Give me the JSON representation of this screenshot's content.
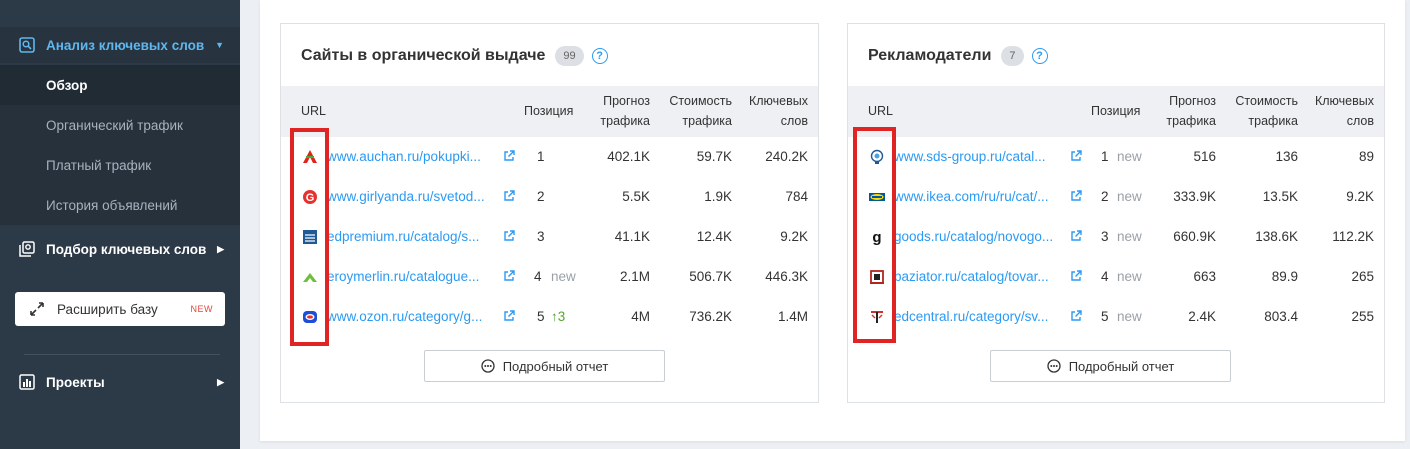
{
  "sidebar": {
    "keyword_analysis": "Анализ ключевых слов",
    "overview": "Обзор",
    "organic_traffic": "Органический трафик",
    "paid_traffic": "Платный трафик",
    "ads_history": "История объявлений",
    "keyword_selection": "Подбор ключевых слов",
    "expand_base": "Расширить базу",
    "new_tag": "NEW",
    "projects": "Проекты"
  },
  "organic": {
    "title": "Сайты в органической выдаче",
    "count": "99",
    "help": "?",
    "headers": {
      "url": "URL",
      "position": "Позиция",
      "traffic_forecast": [
        "Прогноз",
        "трафика"
      ],
      "traffic_cost": [
        "Стоимость",
        "трафика"
      ],
      "keywords": [
        "Ключевых",
        "слов"
      ]
    },
    "rows": [
      {
        "favicon": "auchan-logo-icon",
        "url": "www.auchan.ru/pokupki...",
        "position": "1",
        "pos_note": "",
        "trend": "",
        "forecast": "402.1K",
        "cost": "59.7K",
        "keywords": "240.2K"
      },
      {
        "favicon": "girlyanda-logo-icon",
        "url": "www.girlyanda.ru/svetod...",
        "position": "2",
        "pos_note": "",
        "trend": "",
        "forecast": "5.5K",
        "cost": "1.9K",
        "keywords": "784"
      },
      {
        "favicon": "ledpremium-logo-icon",
        "url": "edpremium.ru/catalog/s...",
        "position": "3",
        "pos_note": "",
        "trend": "",
        "forecast": "41.1K",
        "cost": "12.4K",
        "keywords": "9.2K"
      },
      {
        "favicon": "leroymerlin-logo-icon",
        "url": "eroymerlin.ru/catalogue...",
        "position": "4",
        "pos_note": "new",
        "trend": "",
        "forecast": "2.1M",
        "cost": "506.7K",
        "keywords": "446.3K"
      },
      {
        "favicon": "ozon-logo-icon",
        "url": "www.ozon.ru/category/g...",
        "position": "5",
        "pos_note": "",
        "trend": "↑3",
        "forecast": "4M",
        "cost": "736.2K",
        "keywords": "1.4M"
      }
    ],
    "report_button": "Подробный отчет"
  },
  "advertisers": {
    "title": "Рекламодатели",
    "count": "7",
    "help": "?",
    "headers": {
      "url": "URL",
      "position": "Позиция",
      "traffic_forecast": [
        "Прогноз",
        "трафика"
      ],
      "traffic_cost": [
        "Стоимость",
        "трафика"
      ],
      "keywords": [
        "Ключевых",
        "слов"
      ]
    },
    "rows": [
      {
        "favicon": "sds-group-logo-icon",
        "url": "www.sds-group.ru/catal...",
        "position": "1",
        "pos_note": "new",
        "forecast": "516",
        "cost": "136",
        "keywords": "89"
      },
      {
        "favicon": "ikea-logo-icon",
        "url": "www.ikea.com/ru/ru/cat/...",
        "position": "2",
        "pos_note": "new",
        "forecast": "333.9K",
        "cost": "13.5K",
        "keywords": "9.2K"
      },
      {
        "favicon": "goods-logo-icon",
        "url": "goods.ru/catalog/novogo...",
        "position": "3",
        "pos_note": "new",
        "forecast": "660.9K",
        "cost": "138.6K",
        "keywords": "112.2K"
      },
      {
        "favicon": "baziator-logo-icon",
        "url": "baziator.ru/catalog/tovar...",
        "position": "4",
        "pos_note": "new",
        "forecast": "663",
        "cost": "89.9",
        "keywords": "265"
      },
      {
        "favicon": "ledcentral-logo-icon",
        "url": "edcentral.ru/category/sv...",
        "position": "5",
        "pos_note": "new",
        "forecast": "2.4K",
        "cost": "803.4",
        "keywords": "255"
      }
    ],
    "report_button": "Подробный отчет"
  },
  "colors": {
    "sidebar_bg": "#2c3946",
    "accent": "#2b9af3",
    "highlight": "#e02424",
    "new_tag": "#e8453c",
    "trend_up": "#55a630"
  }
}
